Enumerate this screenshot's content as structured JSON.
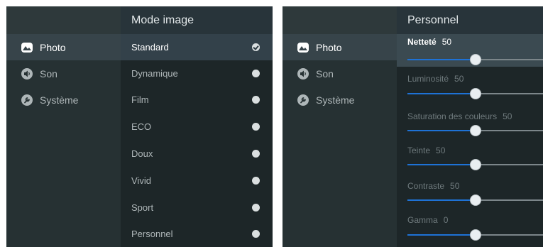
{
  "sidebar": {
    "items": [
      {
        "label": "Photo",
        "icon": "photo-icon"
      },
      {
        "label": "Son",
        "icon": "speaker-icon"
      },
      {
        "label": "Système",
        "icon": "wrench-icon"
      }
    ]
  },
  "picture_mode": {
    "title": "Mode image",
    "options": [
      {
        "label": "Standard",
        "selected": true
      },
      {
        "label": "Dynamique",
        "selected": false
      },
      {
        "label": "Film",
        "selected": false
      },
      {
        "label": "ECO",
        "selected": false
      },
      {
        "label": "Doux",
        "selected": false
      },
      {
        "label": "Vivid",
        "selected": false
      },
      {
        "label": "Sport",
        "selected": false
      },
      {
        "label": "Personnel",
        "selected": false
      }
    ]
  },
  "personal": {
    "title": "Personnel",
    "settings": [
      {
        "label": "Netteté",
        "value": "50",
        "fraction": 0.5
      },
      {
        "label": "Luminosité",
        "value": "50",
        "fraction": 0.5
      },
      {
        "label": "Saturation des couleurs",
        "value": "50",
        "fraction": 0.5
      },
      {
        "label": "Teinte",
        "value": "50",
        "fraction": 0.5
      },
      {
        "label": "Contraste",
        "value": "50",
        "fraction": 0.5
      },
      {
        "label": "Gamma",
        "value": "0",
        "fraction": 0.5
      }
    ]
  },
  "colors": {
    "accent": "#1e72d6",
    "panel_bg": "#1f2a2c",
    "sidebar_bg": "#263133"
  }
}
